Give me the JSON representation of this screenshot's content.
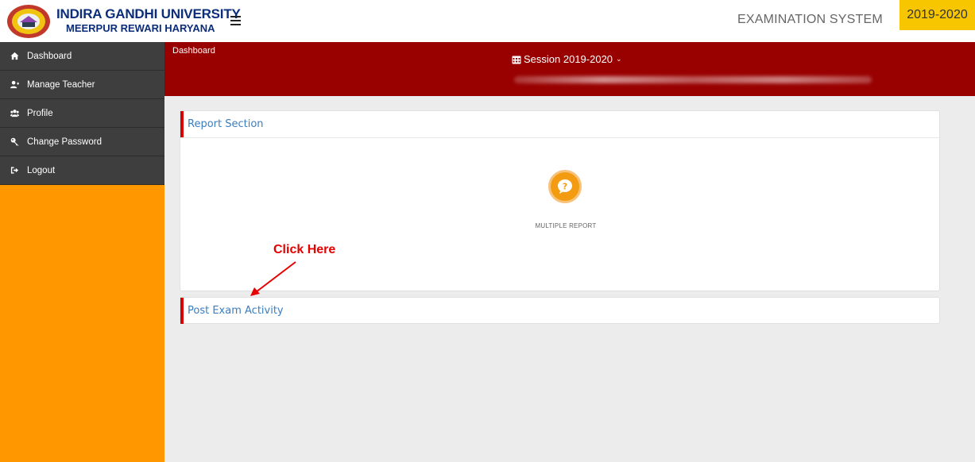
{
  "header": {
    "university_name": "INDIRA GANDHI UNIVERSITY",
    "university_location": "MEERPUR REWARI HARYANA",
    "system_title": "EXAMINATION SYSTEM",
    "year_badge": "2019-2020"
  },
  "sidebar": {
    "items": [
      {
        "label": "Dashboard",
        "icon": "home-icon"
      },
      {
        "label": "Manage Teacher",
        "icon": "add-user-icon"
      },
      {
        "label": "Profile",
        "icon": "users-icon"
      },
      {
        "label": "Change Password",
        "icon": "key-icon"
      },
      {
        "label": "Logout",
        "icon": "sign-out-icon"
      }
    ]
  },
  "band": {
    "breadcrumb": "Dashboard",
    "session_label": "Session  2019-2020"
  },
  "report_section": {
    "title": "Report Section",
    "button_label": "MULTIPLE REPORT",
    "button_icon": "question-bubble-icon"
  },
  "post_exam": {
    "title": "Post Exam Activity"
  },
  "annotation": {
    "text": "Click Here"
  },
  "colors": {
    "accent_red": "#990000",
    "sidebar_orange": "#ff9800",
    "badge_yellow": "#f7c600",
    "title_blue": "#3a7ec0"
  }
}
